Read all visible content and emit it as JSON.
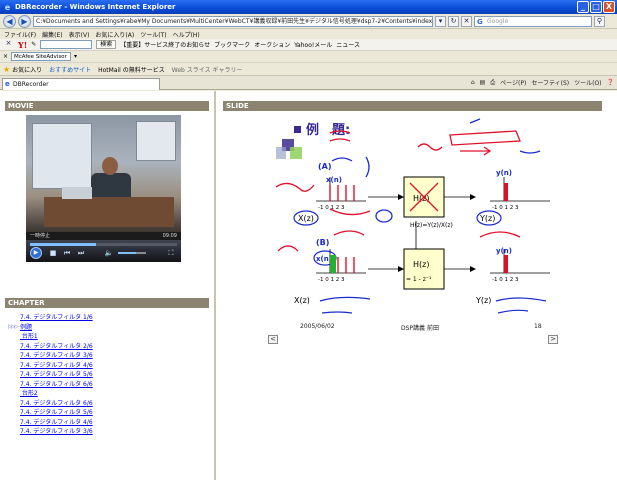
{
  "window": {
    "title": "DBRecorder - Windows Internet Explorer",
    "buttons": [
      "_",
      "□",
      "X"
    ]
  },
  "address": {
    "url": "C:¥Documents and Settings¥rabe¥My Documents¥MultiCenter¥WebCT¥講義収録¥前田先生¥デジタル信号処理¥dsp7-2¥Contents¥index.html",
    "search_placeholder": "Google"
  },
  "menu": [
    "ファイル(F)",
    "編集(E)",
    "表示(V)",
    "お気に入り(A)",
    "ツール(T)",
    "ヘルプ(H)"
  ],
  "yahoo_toolbar": {
    "logo": "Y!",
    "search_button": "検索",
    "items": [
      "【重要】サービス終了のお知らせ",
      "ブックマーク",
      "オークション",
      "Yahoo!メール",
      "ニュース"
    ]
  },
  "mc_toolbar": {
    "box_text": "McAfee SiteAdvisor"
  },
  "favorites": {
    "label": "お気に入り",
    "items": [
      "おすすめサイト",
      "HotMail の無料サービス",
      "Web スライス ギャラリー"
    ]
  },
  "tab": {
    "label": "DBRecorder"
  },
  "command_bar": [
    "ページ(P)",
    "セーフティ(S)",
    "ツール(O)"
  ],
  "movie": {
    "header": "MOVIE",
    "status_left": "一時停止",
    "status_right": "09:09",
    "progress": 0.45,
    "volume": 0.65
  },
  "chapter": {
    "header": "CHAPTER",
    "current_index": 1,
    "items": [
      "7.4. デジタルフィルタ 1/6",
      "例題",
      " 台形1",
      "7.4. デジタルフィルタ 2/6",
      "7.4. デジタルフィルタ 3/6",
      "7.4. デジタルフィルタ 4/6",
      "7.4. デジタルフィルタ 5/6",
      "7.4. デジタルフィルタ 6/6",
      " 台形2",
      "7.4. デジタルフィルタ 6/6",
      "7.4. デジタルフィルタ 5/6",
      "7.4. デジタルフィルタ 4/6",
      "7.4. デジタルフィルタ 3/6"
    ]
  },
  "slide": {
    "header": "SLIDE",
    "title": "例　題:",
    "label_a": "(A)",
    "label_b": "(B)",
    "xn": "x(n)",
    "yn": "y(n)",
    "hz": "H(z)",
    "xz": "X(z)",
    "yz": "Y(z)",
    "hz_eq": "= 1 - z⁻¹",
    "axis_ticks": "-1  0  1  2  3",
    "date": "2005/06/02",
    "author": "DSP講義  前田",
    "page": "18",
    "prev": "<",
    "next": ">"
  },
  "colors": {
    "titlebar": "#0b4bd8",
    "section_header": "#8c8470",
    "link": "#0000ee",
    "ink_red": "#e0102a",
    "ink_blue": "#1a2ad0",
    "slide_title": "#3a2a90"
  }
}
